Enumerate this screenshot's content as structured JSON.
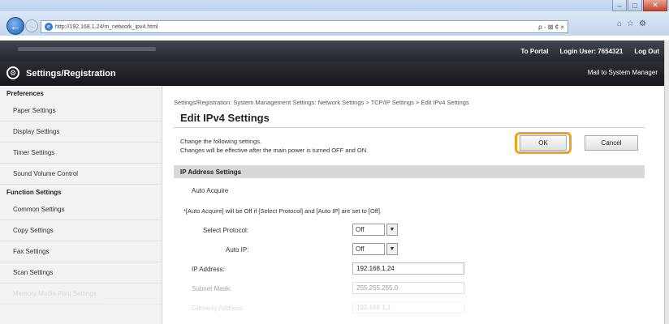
{
  "browser": {
    "url": "http://192.168.1.24/m_network_ipv4.html",
    "search_text": "ρ - ⊠ ¢ ×",
    "window_controls": {
      "minimize": "–",
      "maximize": "□",
      "close": "✕"
    },
    "icons": [
      "back-arrow-icon",
      "forward-arrow-icon",
      "ie-icon",
      "home-icon",
      "star-icon",
      "gear-icon"
    ]
  },
  "toolbar": {
    "portal_link": "To Portal",
    "login_label": "Login User: 7654321",
    "logout_link": "Log Out"
  },
  "header": {
    "title": "Settings/Registration",
    "mail_link": "Mail to System Manager"
  },
  "sidebar": {
    "preferences_heading": "Preferences",
    "preferences_items": [
      "Paper Settings",
      "Display Settings",
      "Timer Settings",
      "Sound Volume Control"
    ],
    "function_heading": "Function Settings",
    "function_items": [
      "Common Settings",
      "Copy Settings",
      "Fax Settings",
      "Scan Settings",
      "Memory Media Print Settings"
    ]
  },
  "main": {
    "breadcrumb": "Settings/Registration: System Management Settings: Network Settings > TCP/IP Settings > Edit IPv4 Settings",
    "page_title": "Edit IPv4 Settings",
    "description_line1": "Change the following settings.",
    "description_line2": "Changes will be effective after the main power is turned OFF and ON.",
    "ok_label": "OK",
    "cancel_label": "Cancel",
    "section_title": "IP Address Settings",
    "auto_acquire_label": "Auto Acquire",
    "auto_acquire_note": "*[Auto Acquire] will be Off if [Select Protocol] and [Auto IP] are set to [Off].",
    "select_protocol_label": "Select Protocol:",
    "select_protocol_value": "Off",
    "auto_ip_label": "Auto IP:",
    "auto_ip_value": "Off",
    "ip_address_label": "IP Address:",
    "ip_address_value": "192.168.1.24",
    "subnet_label": "Subnet Mask:",
    "subnet_value": "255.255.255.0",
    "gateway_label": "Gateway Address:",
    "gateway_value": "192.168.1.1"
  },
  "colors": {
    "highlight": "#f2a11e",
    "toolbar": "#2c2e33",
    "section": "#d8d8d8"
  }
}
